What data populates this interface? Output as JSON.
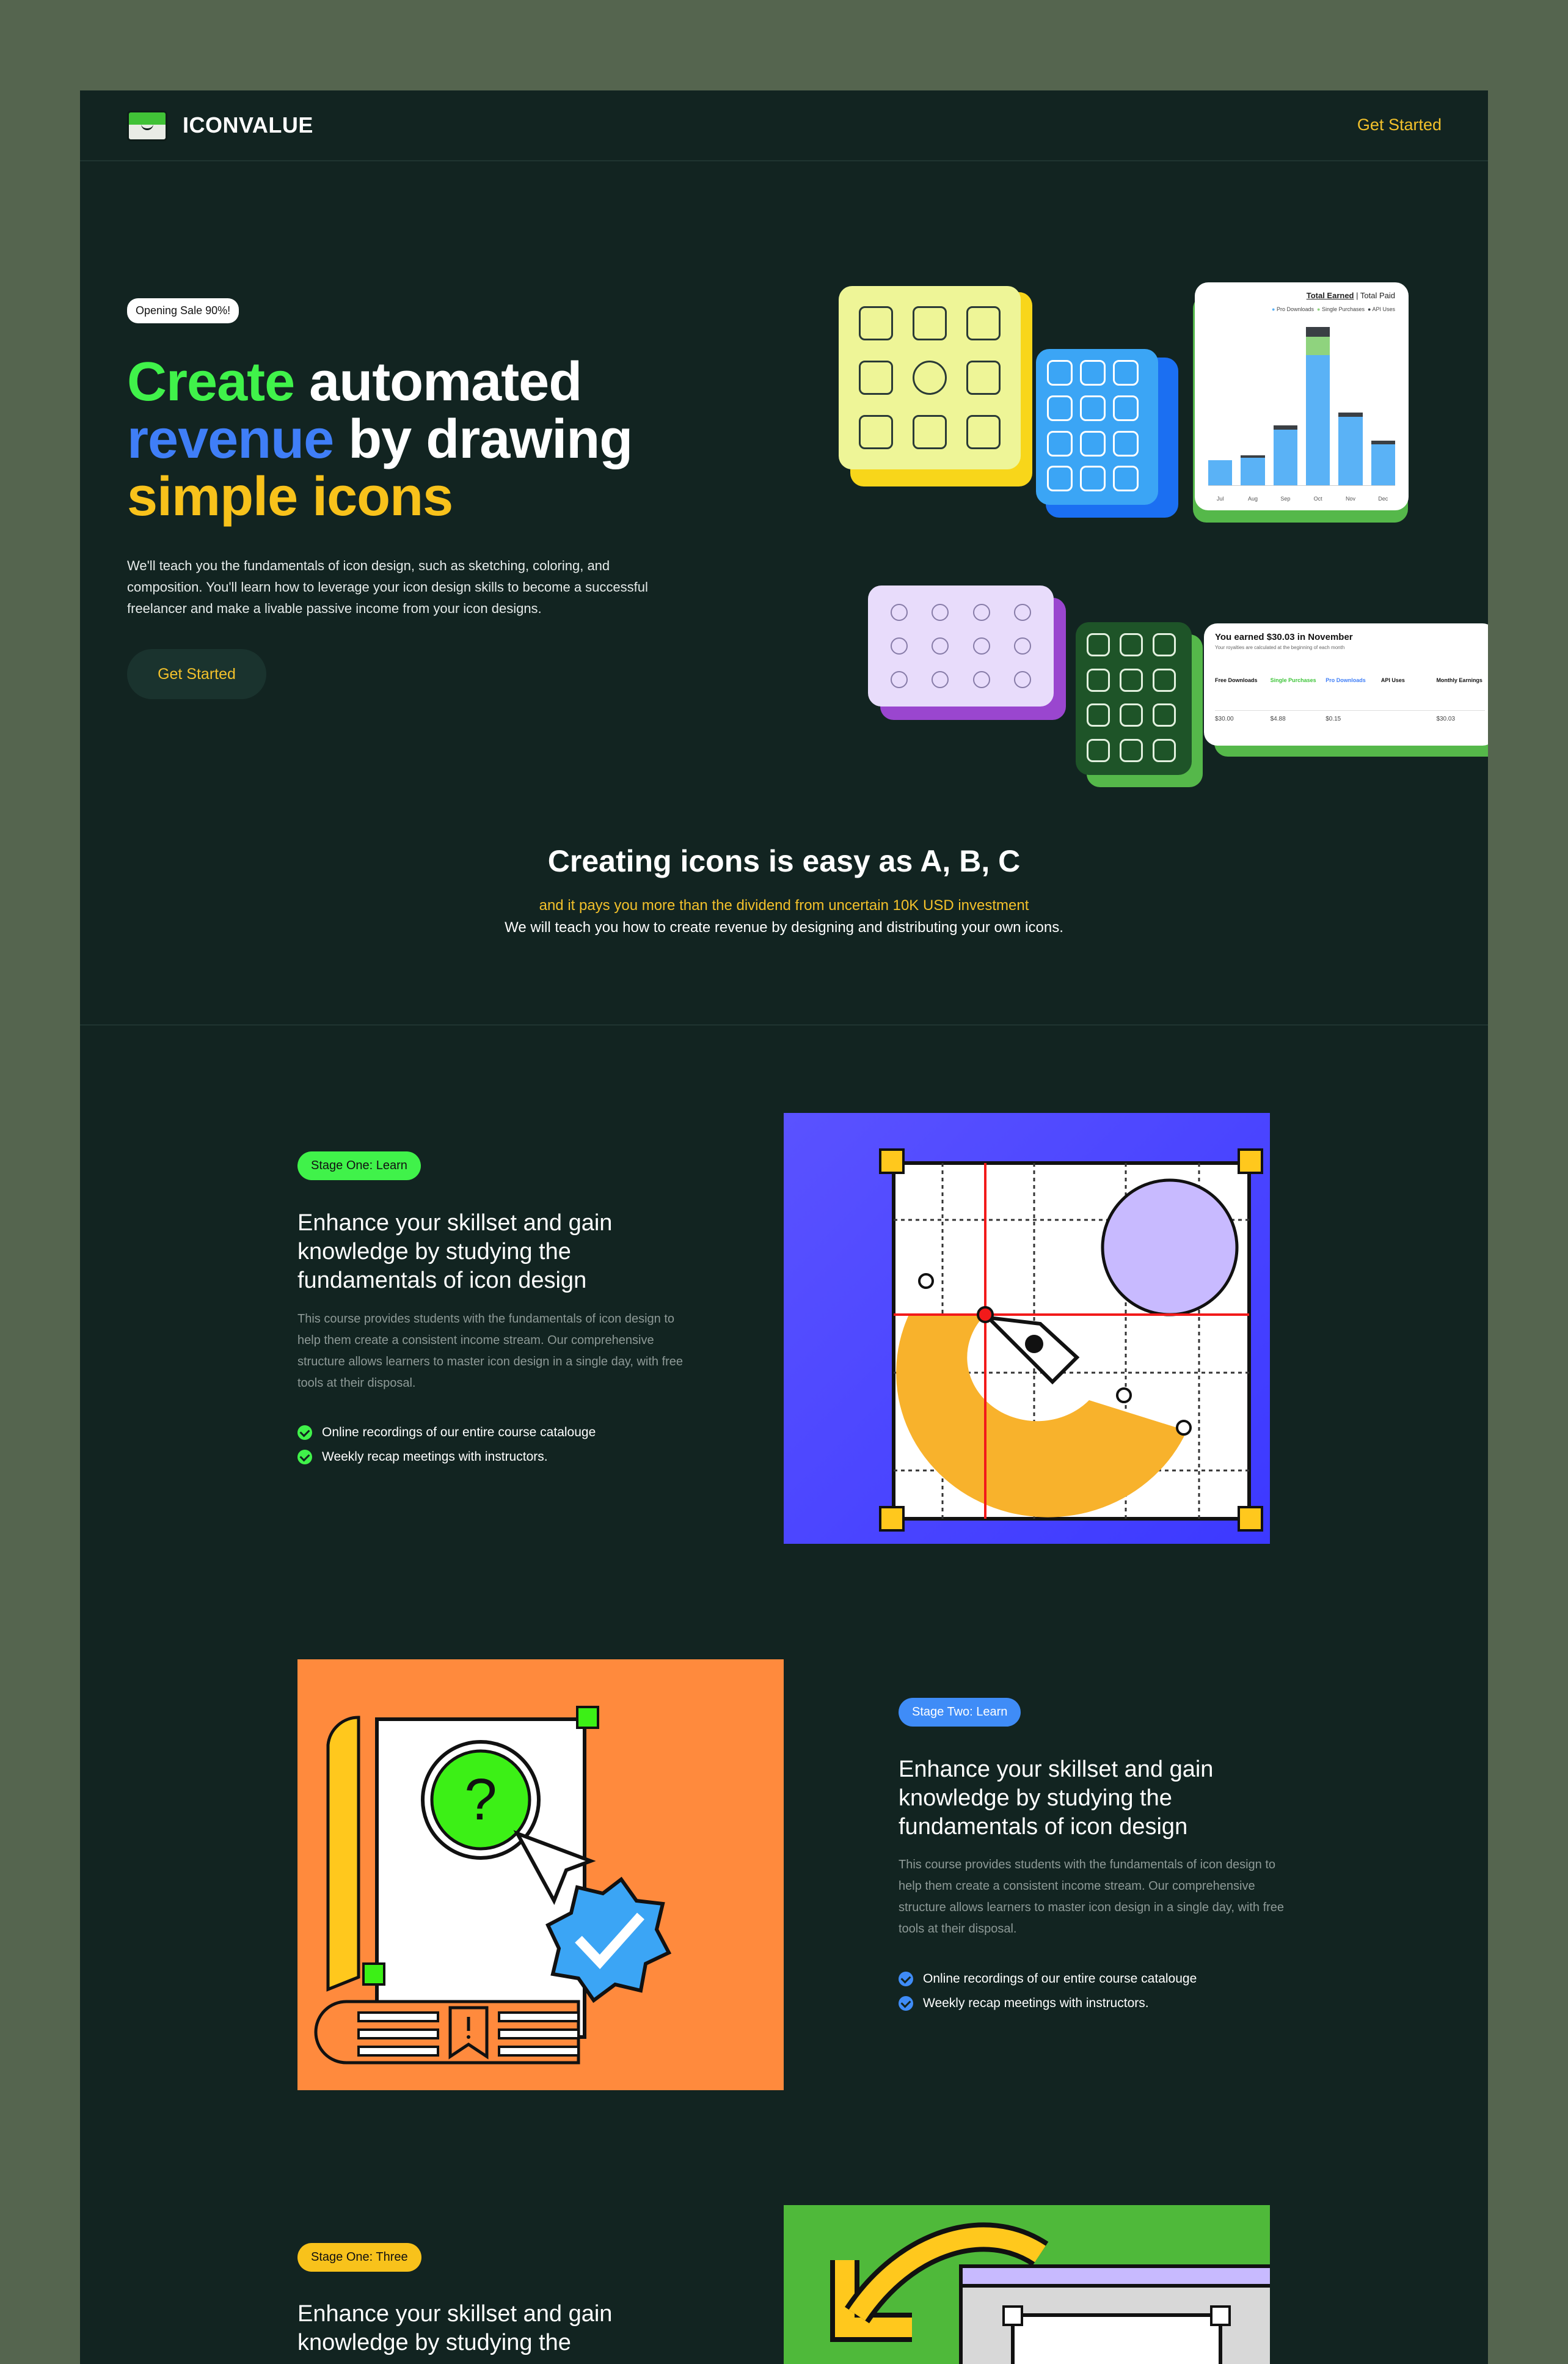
{
  "header": {
    "brand": "ICONVALUE",
    "cta": "Get Started"
  },
  "hero": {
    "badge": "Opening Sale 90%!",
    "title_line1_accent": "Create",
    "title_line1_rest": " automated",
    "title_line2_accent": "revenue",
    "title_line2_rest": " by drawing",
    "title_line3": "simple icons",
    "description": "We'll teach you the fundamentals of icon design, such as sketching, coloring, and composition. You'll learn how to leverage your icon design skills to become a successful freelancer and make a livable passive income from your icon designs.",
    "button": "Get Started",
    "colors": {
      "green": "#40f24a",
      "blue": "#3f7ef7",
      "yellow": "#f8c21b"
    }
  },
  "collage": {
    "chart": {
      "tab_earned": "Total Earned",
      "tab_sep": "|",
      "tab_paid": "Total Paid",
      "legend": [
        "Pro Downloads",
        "Single Purchases",
        "API Uses"
      ],
      "months": [
        "Jul",
        "Aug",
        "Sep",
        "Oct",
        "Nov",
        "Dec"
      ]
    },
    "earnings": {
      "title": "You earned $30.03 in November",
      "subtitle": "Your royalties are calculated at the beginning of each month",
      "columns": [
        "Free Downloads",
        "Single Purchases",
        "Pro Downloads",
        "API Uses",
        "Monthly Earnings"
      ],
      "values": [
        "$30.00",
        "$4.88",
        "$0.15",
        "",
        "$30.03"
      ]
    }
  },
  "intro": {
    "title": "Creating icons is easy as A, B, C",
    "sub1": "and it pays you more than the dividend from uncertain 10K USD investment",
    "sub2": "We will teach you how to create revenue by designing and distributing your own icons."
  },
  "stages": [
    {
      "tag": "Stage One: Learn",
      "title": "Enhance your skillset and gain knowledge by studying the fundamentals of icon design",
      "description": "This course provides students with the fundamentals of icon design to help them create a consistent income stream. Our comprehensive structure allows learners to master icon design in a single day, with free tools at their disposal.",
      "checks": [
        "Online recordings of our entire course catalouge",
        "Weekly recap meetings with instructors."
      ],
      "tag_color": "#40f24a",
      "illustration_bg": "#4b4bff"
    },
    {
      "tag": "Stage Two: Learn",
      "title": "Enhance your skillset and gain knowledge by studying the fundamentals of icon design",
      "description": "This course provides students with the fundamentals of icon design to help them create a consistent income stream. Our comprehensive structure allows learners to master icon design in a single day, with free tools at their disposal.",
      "checks": [
        "Online recordings of our entire course catalouge",
        "Weekly recap meetings with instructors."
      ],
      "tag_color": "#3f8cf7",
      "illustration_bg": "#ff8a3d"
    },
    {
      "tag": "Stage One: Three",
      "title": "Enhance your skillset and gain knowledge by studying the",
      "tag_color": "#f8c21b",
      "illustration_bg": "#4fb93a"
    }
  ]
}
